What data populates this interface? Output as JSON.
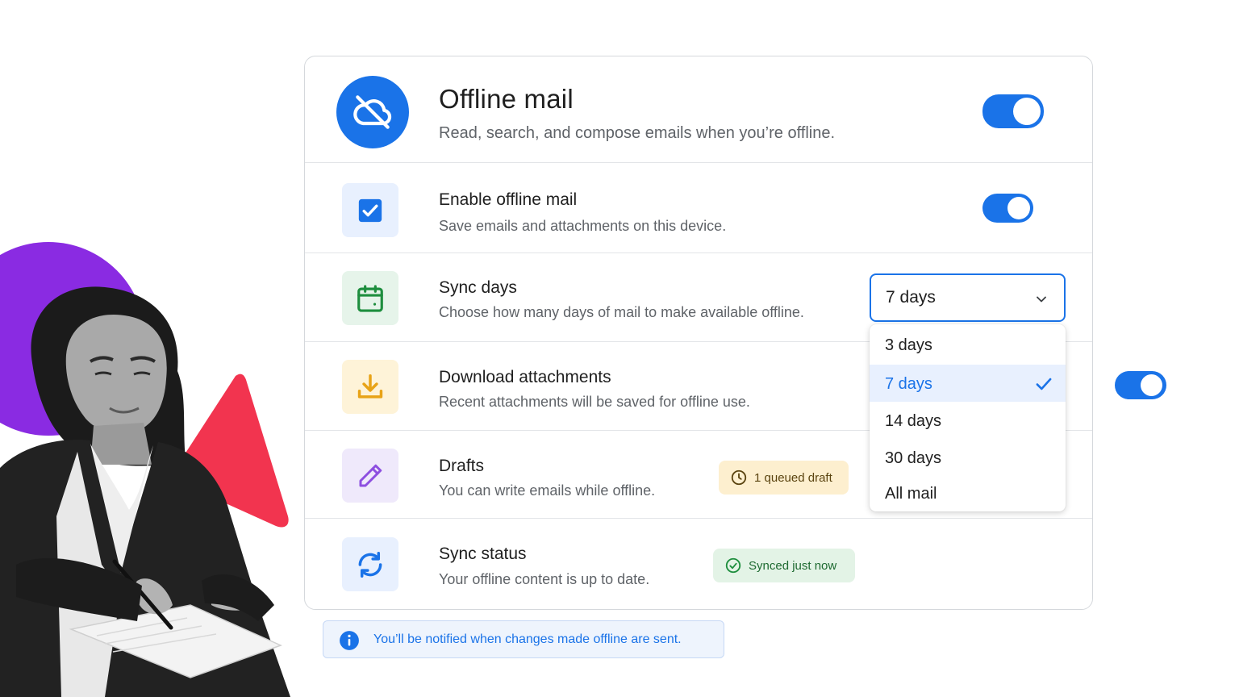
{
  "header": {
    "title": "Offline mail",
    "subtitle": "Read, search, and compose emails when you’re offline.",
    "toggle_on": true
  },
  "rows": {
    "enable": {
      "title": "Enable offline mail",
      "subtitle": "Save emails and attachments on this device.",
      "toggle_on": true
    },
    "sync_days": {
      "title": "Sync days",
      "subtitle": "Choose how many days of mail to make available offline.",
      "selected": "7 days"
    },
    "attachments": {
      "title": "Download attachments",
      "subtitle": "Recent attachments will be saved for offline use.",
      "toggle_on": true
    },
    "drafts": {
      "title": "Drafts",
      "subtitle": "You can write emails while offline.",
      "badge": "1 queued draft"
    },
    "sync_status": {
      "title": "Sync status",
      "subtitle": "Your offline content is up to date.",
      "badge": "Synced just now"
    }
  },
  "dropdown": {
    "options": [
      "3 days",
      "7 days",
      "14 days",
      "30 days",
      "All mail"
    ],
    "selected_index": 1
  },
  "info_banner": {
    "text": "You’ll be notified when changes made offline are sent."
  },
  "colors": {
    "accent": "#1a73e8",
    "badge_amber": "#fdefcf",
    "badge_green": "#e3f3e6"
  },
  "icons": [
    "cloud-off-icon",
    "checkbox-icon",
    "calendar-icon",
    "download-icon",
    "pencil-icon",
    "sync-icon",
    "clock-icon",
    "check-circle-icon",
    "chevron-down-icon",
    "check-icon",
    "info-icon"
  ]
}
